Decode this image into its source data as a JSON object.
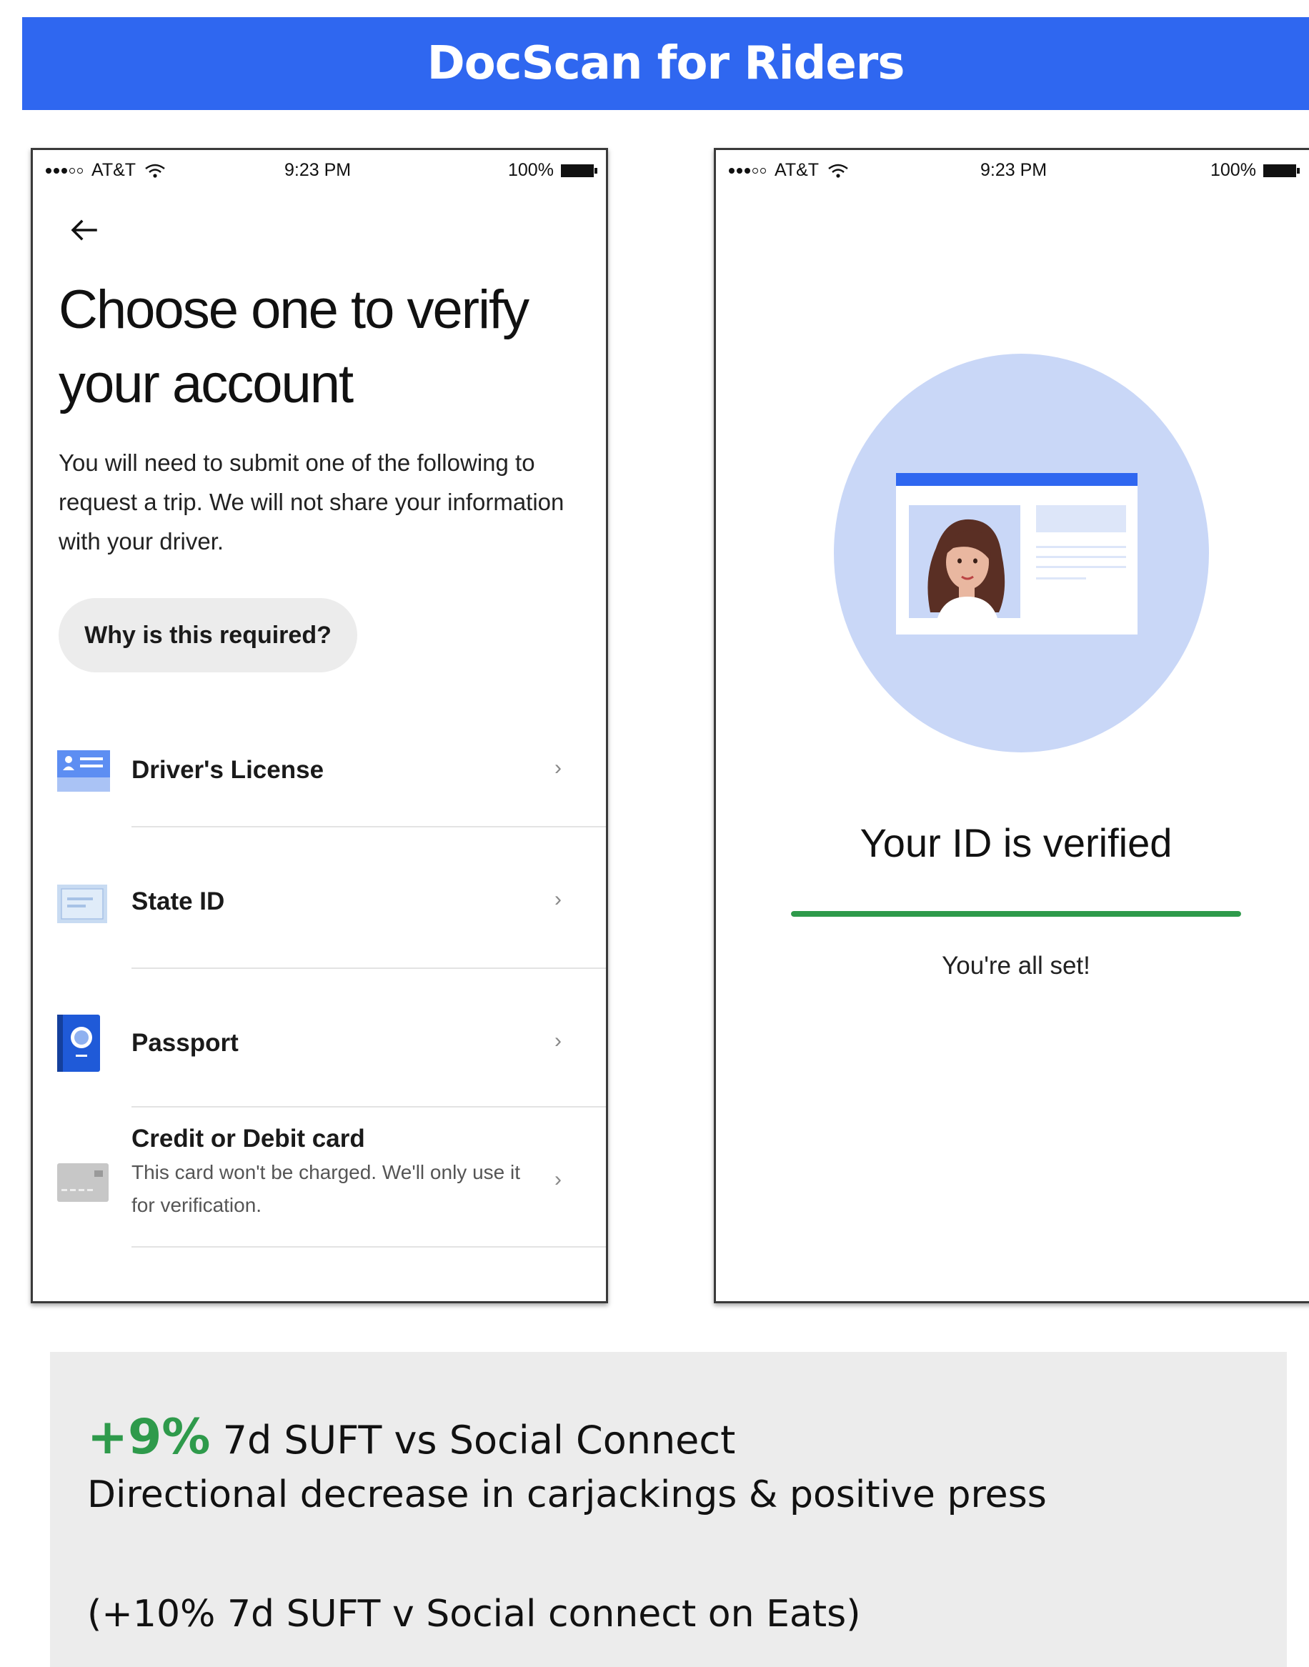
{
  "banner": {
    "title": "DocScan for Riders"
  },
  "phone_left": {
    "status": {
      "carrier": "AT&T",
      "time": "9:23 PM",
      "battery": "100%"
    },
    "headline": "Choose one to verify your account",
    "description": "You will need to submit one of the following to request a trip. We will not share your information with your driver.",
    "why_button": "Why is this required?",
    "options": [
      {
        "label": "Driver's License",
        "icon": "drivers-license-icon"
      },
      {
        "label": "State ID",
        "icon": "state-id-icon"
      },
      {
        "label": "Passport",
        "icon": "passport-icon"
      },
      {
        "label": "Credit or Debit card",
        "sublabel": "This card won't be charged. We'll only use it for verification.",
        "icon": "credit-card-icon"
      }
    ],
    "chevron": "›"
  },
  "phone_right": {
    "status": {
      "carrier": "AT&T",
      "time": "9:23 PM",
      "battery": "100%"
    },
    "title": "Your ID is verified",
    "progress": 1.0,
    "subtitle": "You're all set!"
  },
  "results": {
    "metric": "+9%",
    "line1_rest": " 7d SUFT vs Social Connect",
    "line2": "Directional decrease in carjackings & positive press",
    "line3": "(+10% 7d SUFT v Social connect on Eats)"
  },
  "colors": {
    "brand_blue": "#2f67f0",
    "success_green": "#2e9a4b",
    "illus_blue": "#c9d7f7"
  }
}
